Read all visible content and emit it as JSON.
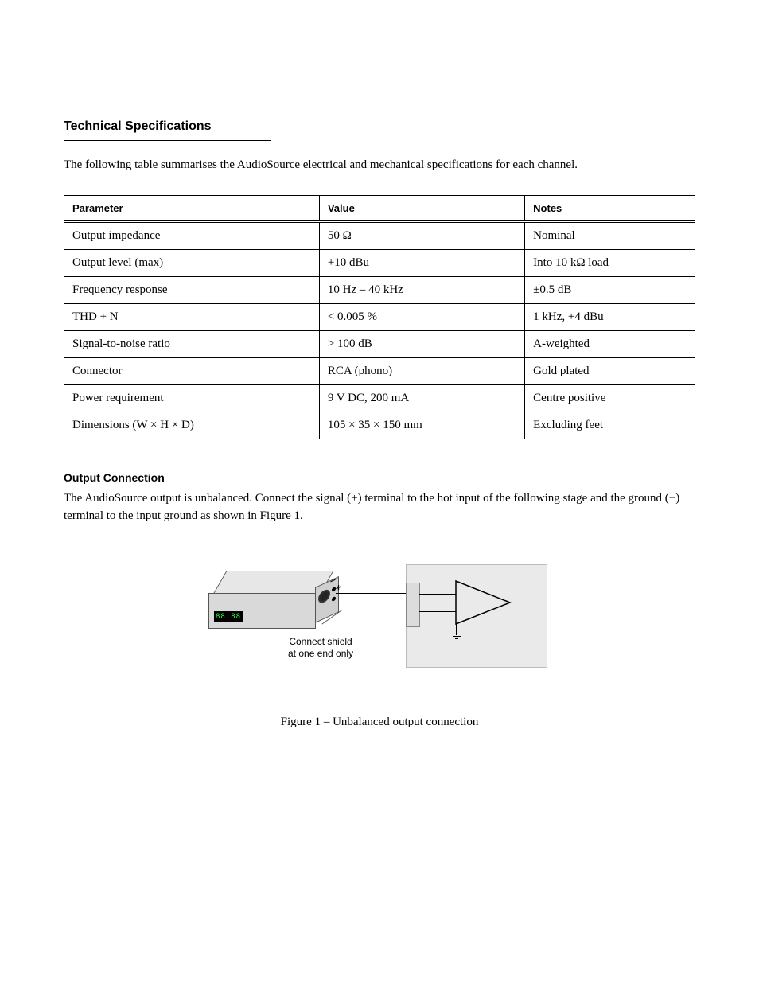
{
  "section_title": "Technical Specifications",
  "intro": "The following table summarises the AudioSource electrical and mechanical specifications for each channel.",
  "table": {
    "headers": [
      "Parameter",
      "Value",
      "Notes"
    ],
    "rows": [
      [
        "Output impedance",
        "50 Ω",
        "Nominal"
      ],
      [
        "Output level (max)",
        "+10 dBu",
        "Into 10 kΩ load"
      ],
      [
        "Frequency response",
        "10 Hz – 40 kHz",
        "±0.5 dB"
      ],
      [
        "THD + N",
        "< 0.005 %",
        "1 kHz, +4 dBu"
      ],
      [
        "Signal-to-noise ratio",
        "> 100 dB",
        "A-weighted"
      ],
      [
        "Connector",
        "RCA (phono)",
        "Gold plated"
      ],
      [
        "Power requirement",
        "9 V DC, 200 mA",
        "Centre positive"
      ],
      [
        "Dimensions (W × H × D)",
        "105 × 35 × 150 mm",
        "Excluding feet"
      ]
    ]
  },
  "subsections": [
    {
      "heading": "Output Connection",
      "paragraphs": [
        "The AudioSource output is unbalanced. Connect the signal (+) terminal to the hot input of the following stage and the ground (−) terminal to the input ground as shown in Figure 1."
      ]
    }
  ],
  "figure": {
    "minus_symbol": "−",
    "plus_symbol": "+",
    "led_text": "88:88",
    "gnd_note": "Connect shield\nat one end only",
    "caption": "Figure 1 – Unbalanced output connection"
  }
}
